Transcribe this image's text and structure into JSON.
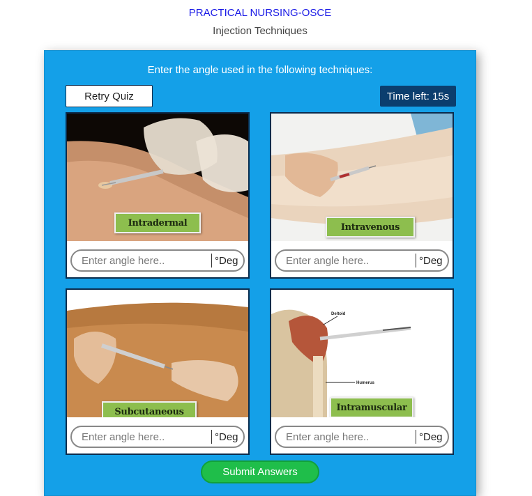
{
  "header": {
    "title": "PRACTICAL NURSING-OSCE",
    "subtitle": "Injection Techniques"
  },
  "quiz": {
    "instruction": "Enter the angle used in the following techniques:",
    "retry_label": "Retry Quiz",
    "timer_text": "Time left: 15s",
    "submit_label": "Submit Answers",
    "cards": [
      {
        "label": "Intradermal",
        "placeholder": "Enter angle here..",
        "unit": "°Deg"
      },
      {
        "label": "Intravenous",
        "placeholder": "Enter angle here..",
        "unit": "°Deg"
      },
      {
        "label": "Subcutaneous",
        "placeholder": "Enter angle here..",
        "unit": "°Deg"
      },
      {
        "label": "Intramuscular",
        "placeholder": "Enter angle here..",
        "unit": "°Deg"
      }
    ],
    "diagram_labels": {
      "deltoid": "Deltoid",
      "humerus": "Humerus"
    }
  },
  "colors": {
    "title": "#1a1ae6",
    "panel": "#14a0e8",
    "timer_bg": "#0b3e6e",
    "submit": "#1fbe4a",
    "label_plate": "#8dbe4e"
  }
}
